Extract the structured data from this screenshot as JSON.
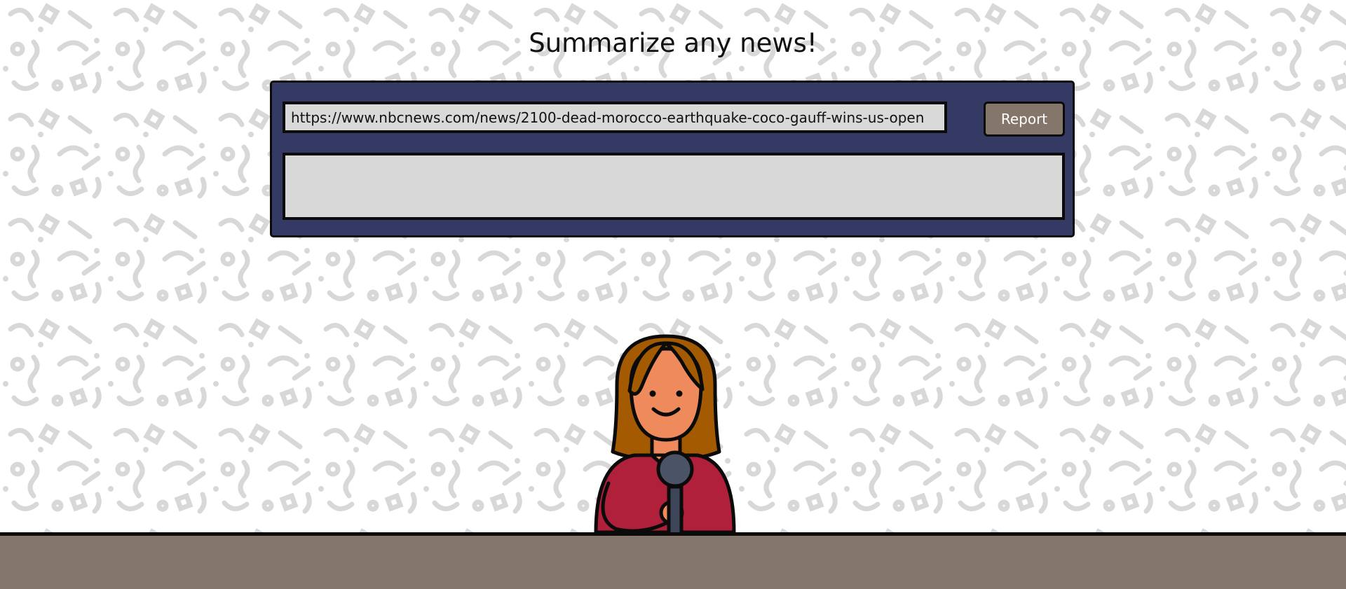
{
  "header": {
    "title": "Summarize any news!"
  },
  "form": {
    "url_value": "https://www.nbcnews.com/news/2100-dead-morocco-earthquake-coco-gauff-wins-us-open",
    "report_label": "Report",
    "summary_text": ""
  },
  "colors": {
    "panel": "#343a63",
    "button": "#85766b",
    "desk": "#85766b",
    "field": "#d9d9d9"
  }
}
